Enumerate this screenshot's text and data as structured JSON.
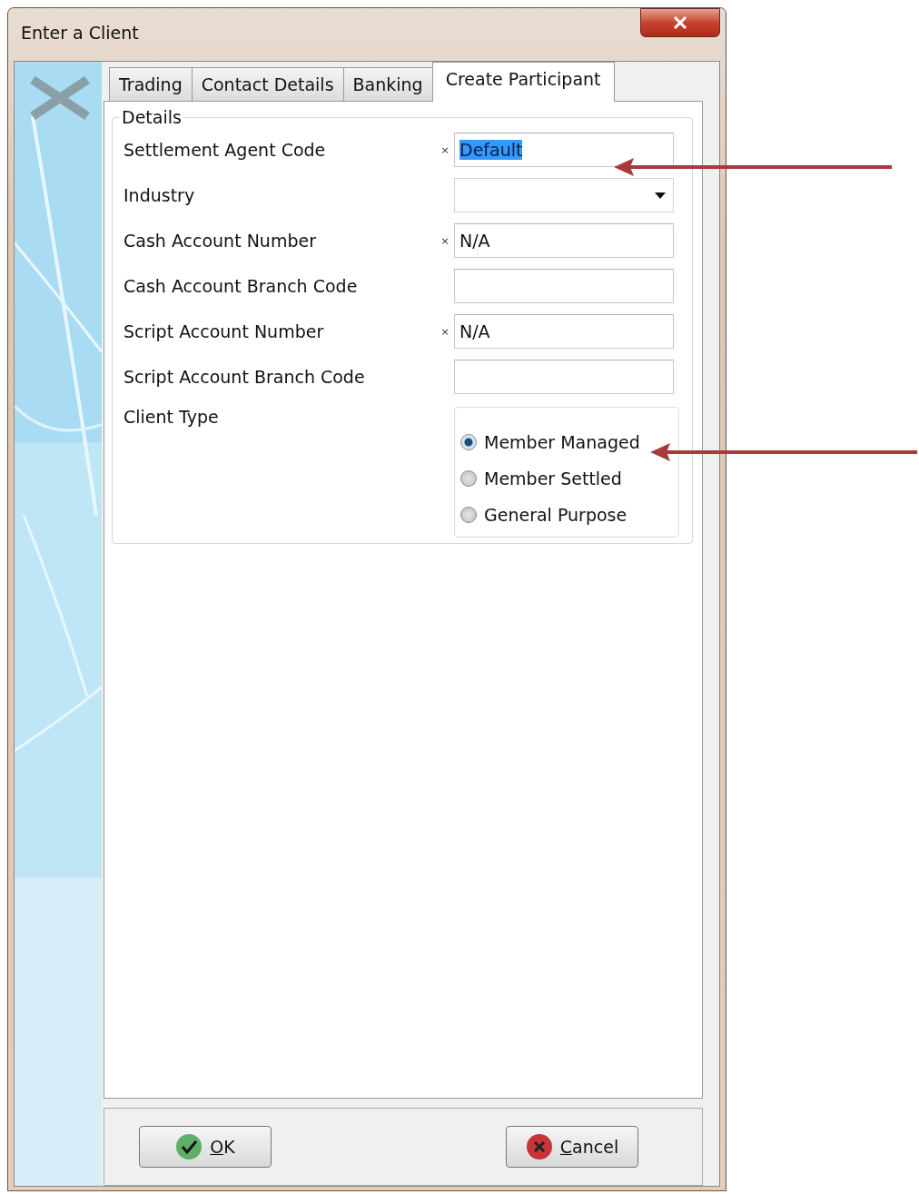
{
  "window": {
    "title": "Enter a Client"
  },
  "tabs": [
    {
      "label": "Trading",
      "selected": false
    },
    {
      "label": "Contact Details",
      "selected": false
    },
    {
      "label": "Banking",
      "selected": false
    },
    {
      "label": "Create Participant",
      "selected": true
    }
  ],
  "group": {
    "title": "Details"
  },
  "fields": [
    {
      "kind": "text",
      "label": "Settlement Agent Code",
      "marker": "×",
      "value": "Default",
      "text_selected": true
    },
    {
      "kind": "dropdown",
      "label": "Industry"
    },
    {
      "kind": "text",
      "label": "Cash Account Number",
      "marker": "×",
      "value": "N/A",
      "text_selected": false
    },
    {
      "kind": "text",
      "label": "Cash Account Branch Code"
    },
    {
      "kind": "text",
      "label": "Script Account Number",
      "marker": "×",
      "value": "N/A",
      "text_selected": false
    },
    {
      "kind": "text",
      "label": "Script Account Branch Code"
    }
  ],
  "client_type": {
    "label": "Client Type",
    "options": [
      {
        "label": "Member Managed",
        "selected": true
      },
      {
        "label": "Member Settled",
        "selected": false
      },
      {
        "label": "General Purpose",
        "selected": false
      }
    ]
  },
  "buttons": [
    {
      "kind": "ok",
      "label": "OK"
    },
    {
      "kind": "cancel",
      "label": "Cancel"
    }
  ],
  "annotation_arrows": [
    {
      "kind": "arrow"
    },
    {
      "kind": "arrow"
    }
  ]
}
